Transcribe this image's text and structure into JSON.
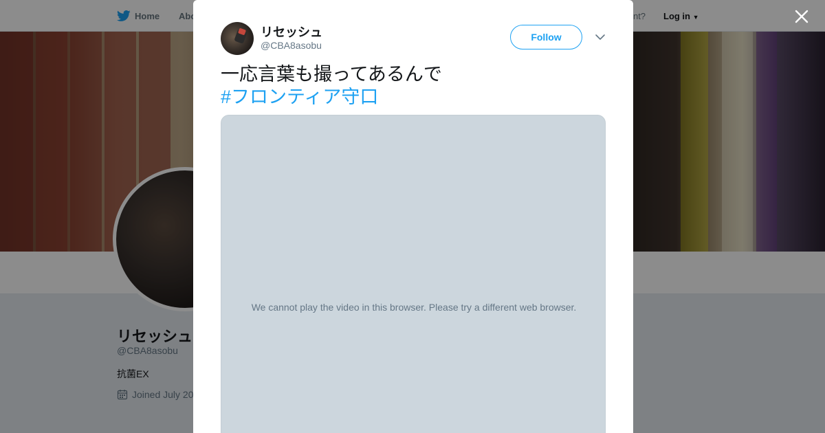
{
  "nav": {
    "home_label": "Home",
    "about_label": "Abo",
    "account_label": "count?",
    "login_label": "Log in"
  },
  "profile": {
    "name": "リセッシュ",
    "handle": "@CBA8asobu",
    "bio": "抗菌EX",
    "joined": "Joined July 20"
  },
  "tweet": {
    "author_name": "リセッシュ",
    "author_handle": "@CBA8asobu",
    "follow_label": "Follow",
    "text": "一応言葉も撮ってあるんで",
    "hashtag": "#フロンティア守口",
    "video_message": "We cannot play the video in this browser. Please try a different web browser."
  },
  "colors": {
    "accent": "#1da1f2",
    "text_primary": "#14171a",
    "text_secondary": "#657786",
    "video_bg": "#ccd6dd"
  },
  "icons": {
    "close": "close-icon",
    "bird": "twitter-bird-icon",
    "caret": "chevron-down-icon",
    "calendar": "calendar-icon"
  }
}
